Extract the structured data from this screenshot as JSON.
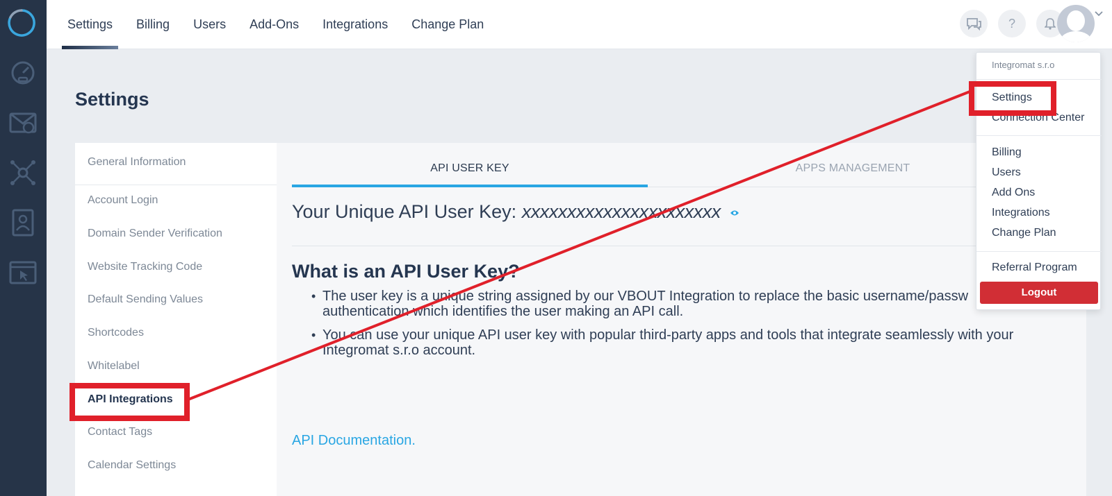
{
  "nav": {
    "items": [
      "Settings",
      "Billing",
      "Users",
      "Add-Ons",
      "Integrations",
      "Change Plan"
    ],
    "active_index": 0
  },
  "header_icons": [
    "chat-icon",
    "help-icon",
    "bell-icon",
    "avatar",
    "chevron-down-icon"
  ],
  "header_help_glyph": "?",
  "page": {
    "title": "Settings"
  },
  "sidebar": {
    "items": [
      "General Information",
      "Account Login",
      "Domain Sender Verification",
      "Website Tracking Code",
      "Default Sending Values",
      "Shortcodes",
      "Whitelabel",
      "API Integrations",
      "Contact Tags",
      "Calendar Settings"
    ],
    "active_index": 7
  },
  "tabs": [
    "API USER KEY",
    "APPS MANAGEMENT"
  ],
  "api_key": {
    "label": "Your Unique API User Key:",
    "value": "xxxxxxxxxxxxxxxxxxxxxx"
  },
  "info": {
    "heading": "What is an API User Key?",
    "bullets": [
      "The user key is a unique string assigned by our VBOUT Integration to replace the basic username/passw authentication which identifies the user making an API call.",
      "You can use your unique API user key with popular third-party apps and tools that integrate seamlessly with your Integromat s.r.o account."
    ],
    "doc_link": "API Documentation."
  },
  "dropdown": {
    "org": "Integromat s.r.o",
    "items": [
      "Settings",
      "Connection Center",
      "Billing",
      "Users",
      "Add Ons",
      "Integrations",
      "Change Plan",
      "Referral Program"
    ],
    "logout": "Logout"
  },
  "colors": {
    "rail": "#263448",
    "accent": "#29a6e3",
    "annotation": "#e0202a",
    "logout": "#d12e35"
  }
}
